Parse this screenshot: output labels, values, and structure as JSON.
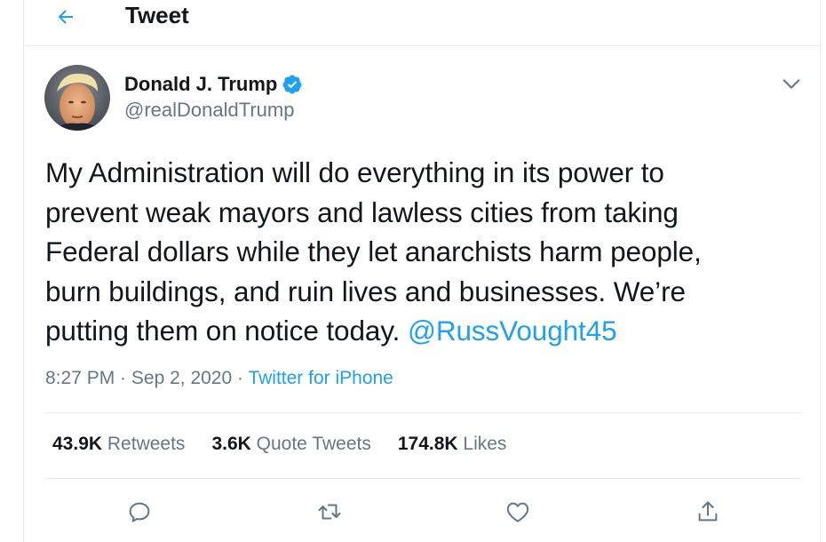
{
  "header": {
    "back_icon": "back-arrow-icon",
    "title": "Tweet"
  },
  "tweet": {
    "author": {
      "name": "Donald J. Trump",
      "handle": "@realDonaldTrump",
      "verified": true
    },
    "text_lines": [
      "My Administration will do everything in its power to",
      "prevent weak mayors and lawless cities from taking",
      "Federal dollars while they let anarchists harm people,",
      "burn buildings, and ruin lives and businesses. We’re",
      "putting them on notice today. "
    ],
    "mention": "@RussVought45",
    "time": "8:27 PM",
    "separator": " · ",
    "date": "Sep 2, 2020",
    "source": "Twitter for iPhone"
  },
  "stats": {
    "retweets": {
      "value": "43.9K",
      "label": "Retweets"
    },
    "quote_tweets": {
      "value": "3.6K",
      "label": "Quote Tweets"
    },
    "likes": {
      "value": "174.8K",
      "label": "Likes"
    }
  },
  "actions": [
    "reply-icon",
    "retweet-icon",
    "like-icon",
    "share-icon"
  ],
  "colors": {
    "accent": "#1da1f2",
    "text": "#14171a",
    "secondary": "#657786",
    "border": "#e6ecf0"
  }
}
